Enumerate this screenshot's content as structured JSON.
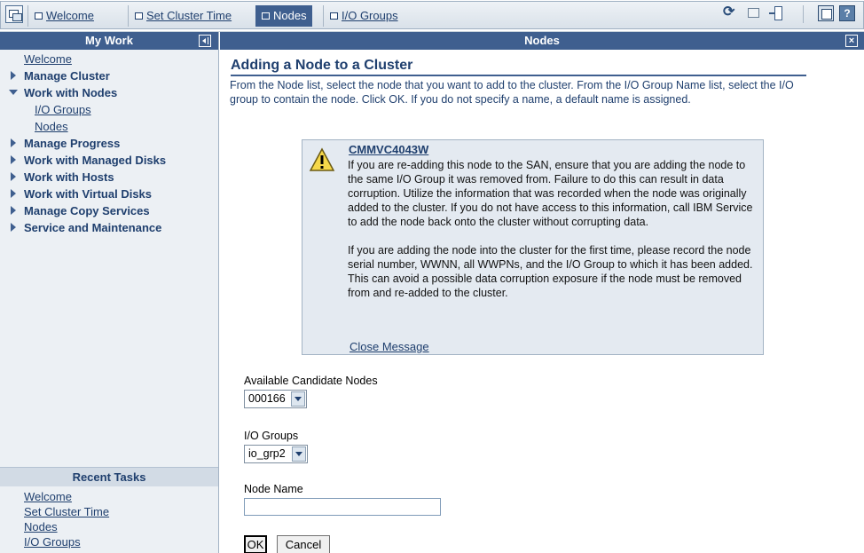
{
  "topbar": {
    "tabs": [
      {
        "label": "Welcome",
        "active": false
      },
      {
        "label": "Set Cluster Time",
        "active": false
      },
      {
        "label": "Nodes",
        "active": true
      },
      {
        "label": "I/O Groups",
        "active": false
      }
    ],
    "icons": [
      "task-list-icon",
      "sync-icon",
      "monitor-icon",
      "logout-icon",
      "maximize-icon",
      "help-icon"
    ],
    "help_label": "?"
  },
  "leftpanel": {
    "title": "My Work",
    "nav": [
      {
        "label": "Welcome",
        "kind": "link"
      },
      {
        "label": "Manage Cluster",
        "kind": "group",
        "expanded": false
      },
      {
        "label": "Work with Nodes",
        "kind": "group",
        "expanded": true
      },
      {
        "label": "I/O Groups",
        "kind": "sub"
      },
      {
        "label": "Nodes",
        "kind": "sub"
      },
      {
        "label": "Manage Progress",
        "kind": "group",
        "expanded": false
      },
      {
        "label": "Work with Managed Disks",
        "kind": "group",
        "expanded": false
      },
      {
        "label": "Work with Hosts",
        "kind": "group",
        "expanded": false
      },
      {
        "label": "Work with Virtual Disks",
        "kind": "group",
        "expanded": false
      },
      {
        "label": "Manage Copy Services",
        "kind": "group",
        "expanded": false
      },
      {
        "label": "Service and Maintenance",
        "kind": "group",
        "expanded": false
      }
    ],
    "recent_title": "Recent Tasks",
    "recent": [
      "Welcome",
      "Set Cluster Time",
      "Nodes",
      "I/O Groups"
    ]
  },
  "main": {
    "header": "Nodes",
    "close_label": "×",
    "title": "Adding a Node to a Cluster",
    "intro": "From the Node list, select the node that you want to add to the cluster. From the I/O Group Name list, select the I/O group to contain the node. Click OK. If you do not specify a name, a default name is assigned.",
    "warning": {
      "code": "CMMVC4043W",
      "p1": "If you are re-adding this node to the SAN, ensure that you are adding the node to the same I/O Group it was removed from. Failure to do this can result in data corruption. Utilize the information that was recorded when the node was originally added to the cluster. If you do not have access to this information, call IBM Service to add the node back onto the cluster without corrupting data.",
      "p2": "If you are adding the node into the cluster for the first time, please record the node serial number, WWNN, all WWPNs, and the I/O Group to which it has been added. This can avoid a possible data corruption exposure if the node must be removed from and re-added to the cluster.",
      "close_label": "Close Message"
    },
    "candidate_label": "Available Candidate Nodes",
    "candidate_value": "000166",
    "iogroup_label": "I/O Groups",
    "iogroup_value": "io_grp2",
    "nodename_label": "Node Name",
    "nodename_value": "",
    "ok_label": "OK",
    "cancel_label": "Cancel"
  }
}
